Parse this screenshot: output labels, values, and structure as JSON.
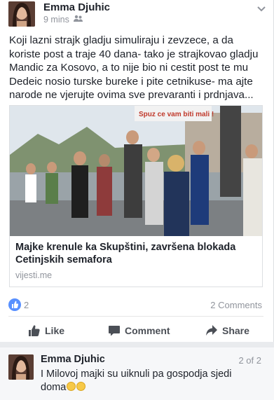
{
  "post": {
    "author": "Emma Djuhic",
    "time": "9 mins",
    "audience_icon": "friends-icon",
    "text": "Koji lazni strajk gladju simuliraju i zevzece, a da koriste post a traje 40 dana- tako je strajkovao gladju Mandic za Kosovo,  a to nije bio ni cestit post te mu Dedeic nosio turske bureke i pite cetnikuse- ma ajte narode ne vjerujte ovima sve prevaranti i prdnjava...",
    "link": {
      "image_banner_text": "Spuz ce vam biti mali !",
      "title": "Majke krenule ka Skupštini, završena blokada Cetinjskih semafora",
      "domain": "vijesti.me"
    },
    "reactions_count": "2",
    "comments_count": "2 Comments",
    "actions": {
      "like": "Like",
      "comment": "Comment",
      "share": "Share"
    }
  },
  "comment": {
    "author": "Emma Djuhic",
    "counter": "2 of 2",
    "text": "I Milovoj majki su uiknuli pa gospodja sjedi doma"
  },
  "colors": {
    "accent": "#5890ff",
    "text": "#1d2129",
    "muted": "#90949c"
  }
}
